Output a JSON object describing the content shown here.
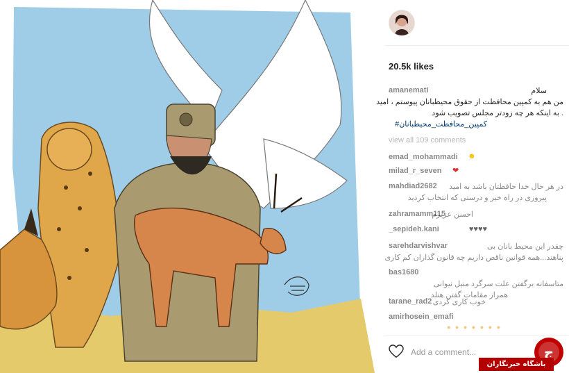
{
  "post": {
    "likes": "20.5k likes",
    "caption": {
      "username": "amanemati",
      "lines": [
        "سلام",
        "من هم به کمپین محافظت از حقوق محیطبانان پیوستم ، امید",
        ". به اینکه هر چه زودتر مجلس تصویب شود"
      ],
      "hashtags": "کمپین_محافظت_محیطبانان#"
    },
    "view_all": "view all 109 comments",
    "comments": [
      {
        "user": "emad_mohammadi",
        "text": ""
      },
      {
        "user": "milad_r_seven",
        "text": ""
      },
      {
        "user": "mahdiad2682",
        "text": "در هر حال خدا حافظتان باشد به امید",
        "text2": "پیروزی در راه خیر و درستی که انتخاب کردید"
      },
      {
        "user": "zahramamm115",
        "text": "احسن عزیزم"
      },
      {
        "user": "_sepideh.kani",
        "text": "♥♥♥♥"
      },
      {
        "user": "sarehdarvishvar",
        "text": "چقدر این محیط بانان بی",
        "text2": "پناهند...همه قوانین ناقص داریم چه قانون گذاران کم کاری"
      },
      {
        "user": "bas1680",
        "text": "",
        "text2": "متاسفانه برگفتن علت سرگرد منیل نیوانی",
        "text3": "همراز مقامات گفتن هنلد"
      },
      {
        "user": "tarane_rad2",
        "text": "خوب کاری کردی"
      },
      {
        "user": "amirhosein_emafi",
        "text": ""
      }
    ],
    "add_comment_placeholder": "Add a comment..."
  },
  "artwork": {
    "signature": "Alireza Pakdel 2016"
  },
  "watermark": {
    "text": "باشگاه خبرنگاران",
    "logo_letter": "ج"
  },
  "colors": {
    "sky": "#9dcbe6",
    "grass": "#e2c86a",
    "uniform": "#a89a6e",
    "watermark_red": "#b40000"
  }
}
